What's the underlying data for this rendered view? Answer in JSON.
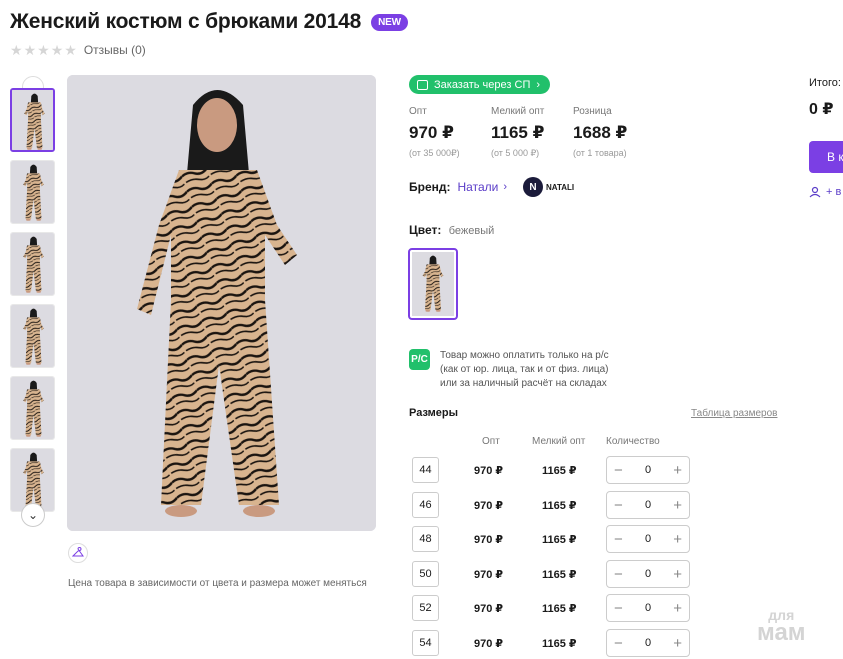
{
  "product": {
    "title": "Женский костюм с брюками 20148",
    "badge": "NEW",
    "reviews_label": "Отзывы (0)",
    "rating_stars": 0,
    "price_note": "Цена товара в зависимости от цвета и размера может меняться"
  },
  "order_sp": {
    "label": "Заказать через СП"
  },
  "prices": [
    {
      "label": "Опт",
      "value": "970 ₽",
      "sub": "(от 35 000₽)"
    },
    {
      "label": "Мелкий опт",
      "value": "1165 ₽",
      "sub": "(от 5 000 ₽)"
    },
    {
      "label": "Розница",
      "value": "1688 ₽",
      "sub": "(от 1 товара)"
    }
  ],
  "brand": {
    "label": "Бренд:",
    "value": "Натали",
    "logo_letter": "N",
    "logo_text": "NATALI"
  },
  "color": {
    "label": "Цвет:",
    "value": "бежевый"
  },
  "payment_note": {
    "icon_text": "Р/С",
    "lines": [
      "Товар можно оплатить только на р/с",
      "(как от юр. лица, так и от физ. лица)",
      "или за наличный расчёт на складах"
    ]
  },
  "sizes": {
    "title": "Размеры",
    "table_link": "Таблица размеров",
    "headers": {
      "opt": "Опт",
      "small": "Мелкий опт",
      "qty": "Количество"
    },
    "rows": [
      {
        "size": "44",
        "opt": "970 ₽",
        "small": "1165 ₽",
        "qty": "0"
      },
      {
        "size": "46",
        "opt": "970 ₽",
        "small": "1165 ₽",
        "qty": "0"
      },
      {
        "size": "48",
        "opt": "970 ₽",
        "small": "1165 ₽",
        "qty": "0"
      },
      {
        "size": "50",
        "opt": "970 ₽",
        "small": "1165 ₽",
        "qty": "0"
      },
      {
        "size": "52",
        "opt": "970 ₽",
        "small": "1165 ₽",
        "qty": "0"
      },
      {
        "size": "54",
        "opt": "970 ₽",
        "small": "1165 ₽",
        "qty": "0"
      }
    ]
  },
  "summary": {
    "total_label": "Итого:",
    "total_value": "0 ₽",
    "cart_button": "В к",
    "favorite_label": "+ в"
  },
  "watermark": {
    "top": "для",
    "bottom": "мам"
  },
  "colors": {
    "accent": "#7b3fe4",
    "green": "#21c06b",
    "tiger_base": "#d8b48f",
    "tiger_stripe": "#1a1410"
  }
}
